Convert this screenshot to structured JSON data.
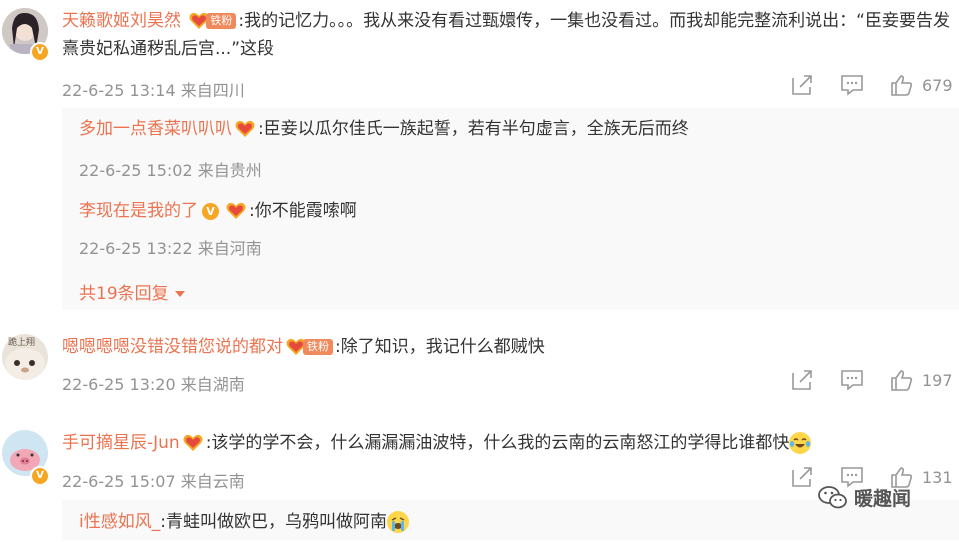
{
  "comments": [
    {
      "user": "天籁歌姬刘昊然",
      "fan_tag": "铁粉",
      "text": ":我的记忆力。。。我从来没有看过甄嬛传，一集也没看过。而我却能完整流利说出：“臣妾要告发熹贵妃私通秽乱后宫...”这段",
      "meta": "22-6-25 13:14 来自四川",
      "likes": "679",
      "replies": [
        {
          "user": "多加一点香菜叭叭叭",
          "text": ":臣妾以瓜尔佳氏一族起誓，若有半句虚言，全族无后而终",
          "meta": "22-6-25 15:02 来自贵州"
        },
        {
          "user": "李现在是我的了",
          "text": ":你不能霞嗦啊",
          "meta": "22-6-25 13:22 来自河南"
        }
      ],
      "more_replies": "共19条回复"
    },
    {
      "user": "嗯嗯嗯嗯没错没错您说的都对",
      "fan_tag": "铁粉",
      "text": ":除了知识，我记什么都贼快",
      "meta": "22-6-25 13:20 来自湖南",
      "likes": "197",
      "avatar_text": "跪上翔"
    },
    {
      "user": "手可摘星辰-Jun",
      "text": ":该学的学不会，什么漏漏漏油波特，什么我的云南的云南怒江的学得比谁都快",
      "meta": "22-6-25 15:07 来自云南",
      "likes": "131",
      "replies": [
        {
          "user": "i性感如风_",
          "text": ":青蛙叫做欧巴，乌鸦叫做阿南"
        }
      ]
    }
  ],
  "watermark": "暖趣闻",
  "colors": {
    "username": "#eb7350",
    "meta": "#939393",
    "badge": "#f5a623"
  },
  "icons": [
    "share-icon",
    "comment-icon",
    "like-icon",
    "fan-heart-icon",
    "verified-badge-icon",
    "laugh-cry-emoji",
    "cry-emoji",
    "wechat-icon"
  ]
}
